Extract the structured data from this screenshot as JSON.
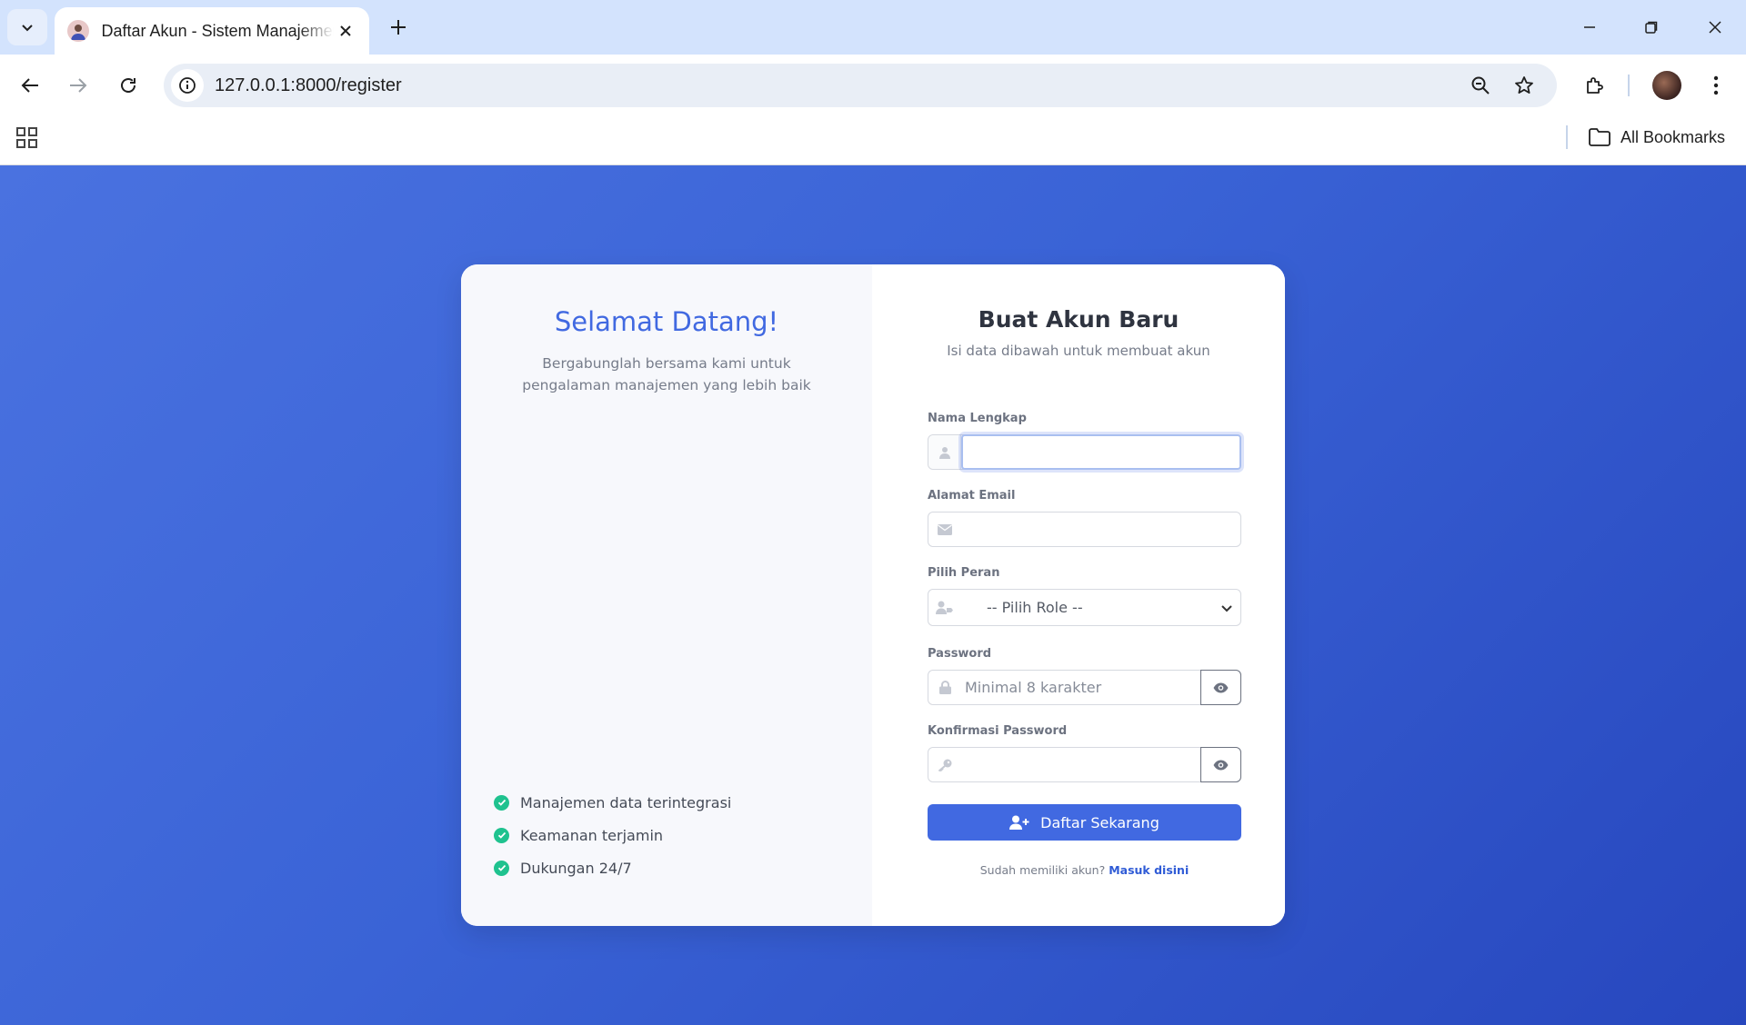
{
  "browser": {
    "tab_title": "Daftar Akun - Sistem Manajemen",
    "url": "127.0.0.1:8000/register",
    "all_bookmarks_label": "All Bookmarks"
  },
  "welcome": {
    "title": "Selamat Datang!",
    "subtitle": "Bergabunglah bersama kami untuk pengalaman manajemen yang lebih baik",
    "features": [
      "Manajemen data terintegrasi",
      "Keamanan terjamin",
      "Dukungan 24/7"
    ]
  },
  "form": {
    "title": "Buat Akun Baru",
    "subtitle": "Isi data dibawah untuk membuat akun",
    "fields": {
      "name": {
        "label": "Nama Lengkap",
        "value": "",
        "placeholder": "",
        "icon": "user-icon"
      },
      "email": {
        "label": "Alamat Email",
        "value": "",
        "placeholder": "",
        "icon": "envelope-icon"
      },
      "role": {
        "label": "Pilih Peran",
        "selected": "-- Pilih Role --",
        "icon": "user-tag-icon"
      },
      "password": {
        "label": "Password",
        "value": "",
        "placeholder": "Minimal 8 karakter",
        "icon": "lock-icon"
      },
      "password_confirm": {
        "label": "Konfirmasi Password",
        "value": "",
        "placeholder": "",
        "icon": "key-icon"
      }
    },
    "submit_label": "Daftar Sekarang",
    "login_prompt": "Sudah memiliki akun?",
    "login_link": "Masuk disini"
  },
  "colors": {
    "accent": "#4169e1",
    "check_green": "#1fc28f",
    "page_gradient_start": "#4a72e0",
    "page_gradient_end": "#2747be"
  }
}
